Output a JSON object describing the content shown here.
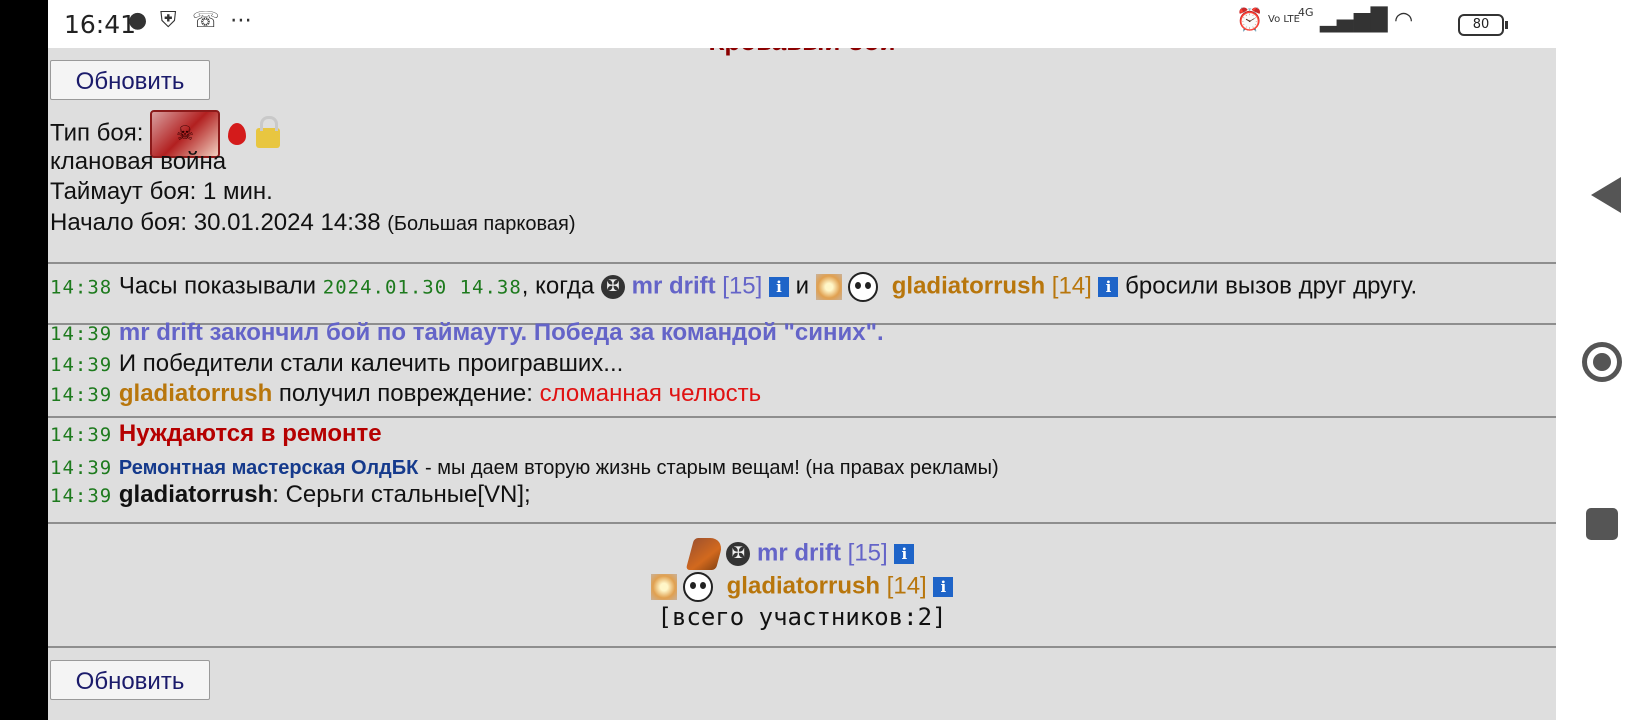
{
  "status_bar": {
    "time": "16:41",
    "left_icons": [
      "chat-icon",
      "shield-icon",
      "missed-call-icon",
      "more-icon"
    ],
    "right_icons": [
      "alarm-icon",
      "volte-icon",
      "signal-4g-icon",
      "wifi-icon"
    ],
    "network": "4G",
    "volte": "Vo LTE",
    "battery": "80"
  },
  "header": {
    "title_partial": "Кровавый бой",
    "refresh_label": "Обновить"
  },
  "battle_info": {
    "type_label": "Тип боя:",
    "type_icons": [
      "battle-scroll-icon",
      "blood-drop-icon",
      "lock-icon"
    ],
    "type_value": "клановая война",
    "timeout": "Таймаут боя: 1 мин.",
    "start_label": "Начало боя: 30.01.2024 14:38",
    "location": "(Большая парковая)"
  },
  "log_block_1": {
    "time": "14:38",
    "text_before": "Часы показывали",
    "clock_value": "2024.01.30 14.38",
    "text_when": ", когда",
    "player1_name": "mr drift",
    "player1_level": "[15]",
    "and": "и",
    "player2_name": "gladiatorrush",
    "player2_level": "[14]",
    "text_after": "бросили вызов друг другу."
  },
  "log_block_2": {
    "line1_time": "14:39",
    "line1_text": "mr drift закончил бой по таймауту. Победа за командой \"синих\".",
    "line2_time": "14:39",
    "line2_text": "И победители стали калечить проигравших...",
    "line3_time": "14:39",
    "line3_player": "gladiatorrush",
    "line3_text": "получил повреждение:",
    "line3_injury": "сломанная челюсть"
  },
  "log_block_3": {
    "line1_time": "14:39",
    "line1_text": "Нуждаются в ремонте",
    "line2_time": "14:39",
    "line2_shop": "Ремонтная мастерская ОлдБК",
    "line2_text": "- мы даем вторую жизнь старым вещам! (на правах рекламы)",
    "line3_time": "14:39",
    "line3_player": "gladiatorrush",
    "line3_text": ": Серьги стальные[VN];"
  },
  "participants": {
    "p1_name": "mr drift",
    "p1_level": "[15]",
    "p2_name": "gladiatorrush",
    "p2_level": "[14]",
    "total": "[всего участников:2]"
  },
  "footer": {
    "refresh_label": "Обновить"
  },
  "colors": {
    "blue_team": "#6464c8",
    "orange_team": "#b8760c",
    "timestamp": "#1d7a1d",
    "injury": "#e01212",
    "repair_header": "#b50000"
  }
}
